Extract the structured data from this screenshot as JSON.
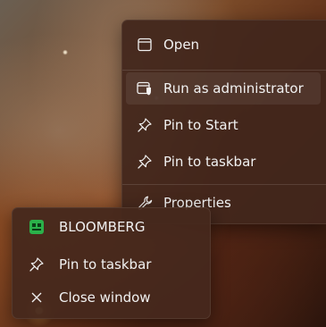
{
  "context_menu": {
    "items": [
      {
        "label": "Open",
        "icon": "window-icon"
      },
      {
        "label": "Run as administrator",
        "icon": "shield-window-icon"
      },
      {
        "label": "Pin to Start",
        "icon": "pin-icon"
      },
      {
        "label": "Pin to taskbar",
        "icon": "pin-icon"
      },
      {
        "label": "Properties",
        "icon": "wrench-icon"
      }
    ]
  },
  "jump_list": {
    "app_name": "BLOOMBERG",
    "items": [
      {
        "label": "Pin to taskbar",
        "icon": "pin-icon"
      },
      {
        "label": "Close window",
        "icon": "close-icon"
      }
    ]
  },
  "colors": {
    "menu_bg": "#42261c",
    "text": "#f2f2f2",
    "app_icon": "#2bb14a"
  }
}
